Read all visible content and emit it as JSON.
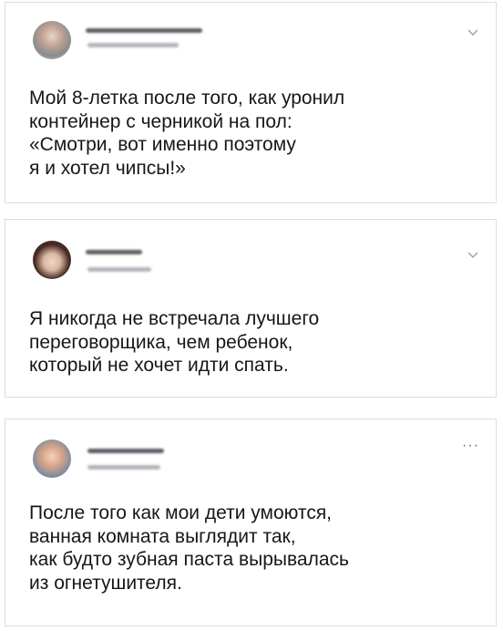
{
  "tweets": [
    {
      "text": "Мой 8-летка после того, как уронил\nконтейнер с черникой на пол:\n«Смотри, вот именно поэтому\nя и хотел чипсы!»",
      "menu_icon": "chevron-down-icon"
    },
    {
      "text": "Я никогда не встречала лучшего\nпереговорщика, чем ребенок,\nкоторый не хочет идти спать.",
      "menu_icon": "chevron-down-icon"
    },
    {
      "text": "После того как мои дети умоются,\nванная комната выглядит так,\nкак будто зубная паста вырывалась\nиз огнетушителя.",
      "menu_icon": "more-icon",
      "menu_glyph": "···"
    }
  ],
  "colors": {
    "border": "#d9dde0",
    "text": "#14171a",
    "icon": "#6b7178"
  }
}
